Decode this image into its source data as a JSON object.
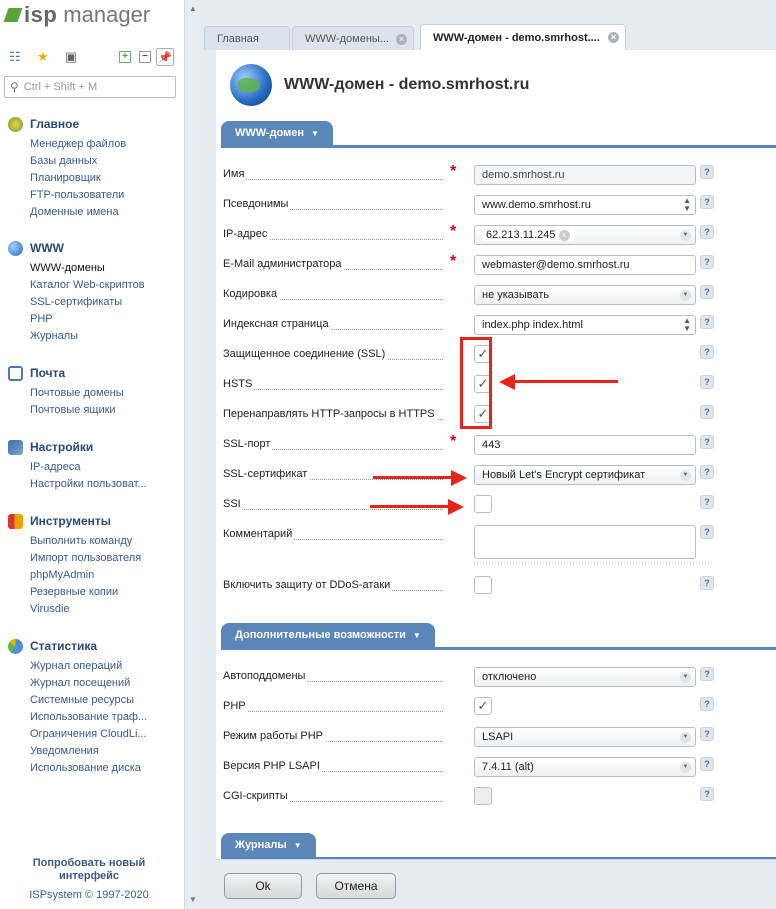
{
  "app": {
    "logo_isp": "isp",
    "logo_manager": "manager"
  },
  "search": {
    "placeholder": "Ctrl + Shift + M"
  },
  "sidebar": {
    "sections": [
      {
        "title": "Главное",
        "items": [
          "Менеджер файлов",
          "Базы данных",
          "Планировщик",
          "FTP-пользователи",
          "Доменные имена"
        ]
      },
      {
        "title": "WWW",
        "items": [
          "WWW-домены",
          "Каталог Web-скриптов",
          "SSL-сертификаты",
          "PHP",
          "Журналы"
        ]
      },
      {
        "title": "Почта",
        "items": [
          "Почтовые домены",
          "Почтовые ящики"
        ]
      },
      {
        "title": "Настройки",
        "items": [
          "IP-адреса",
          "Настройки пользоват..."
        ]
      },
      {
        "title": "Инструменты",
        "items": [
          "Выполнить команду",
          "Импорт пользователя",
          "phpMyAdmin",
          "Резервные копии",
          "Virusdie"
        ]
      },
      {
        "title": "Статистика",
        "items": [
          "Журнал операций",
          "Журнал посещений",
          "Системные ресурсы",
          "Использование траф...",
          "Ограничения CloudLi...",
          "Уведомления",
          "Использование диска"
        ]
      }
    ],
    "active_item": "WWW-домены",
    "try_new": "Попробовать новый интерфейс",
    "copyright": "ISPsystem © 1997-2020"
  },
  "tabs": [
    {
      "label": "Главная"
    },
    {
      "label": "WWW-домены..."
    },
    {
      "label": "WWW-домен - demo.smrhost...."
    }
  ],
  "page": {
    "title": "WWW-домен - demo.smrhost.ru"
  },
  "groups": {
    "main": "WWW-домен",
    "extra": "Дополнительные возможности",
    "logs": "Журналы"
  },
  "form": {
    "name": {
      "label": "Имя",
      "value": "demo.smrhost.ru"
    },
    "aliases": {
      "label": "Псевдонимы",
      "value": "www.demo.smrhost.ru"
    },
    "ip": {
      "label": "IP-адрес",
      "value": "62.213.11.245"
    },
    "email": {
      "label": "E-Mail администратора",
      "value": "webmaster@demo.smrhost.ru"
    },
    "charset": {
      "label": "Кодировка",
      "value": "не указывать"
    },
    "index": {
      "label": "Индексная страница",
      "value": "index.php index.html"
    },
    "ssl": {
      "label": "Защищенное соединение (SSL)",
      "checked": true
    },
    "hsts": {
      "label": "HSTS",
      "checked": true
    },
    "redirect": {
      "label": "Перенаправлять HTTP-запросы в HTTPS",
      "checked": true
    },
    "ssl_port": {
      "label": "SSL-порт",
      "value": "443"
    },
    "ssl_cert": {
      "label": "SSL-сертификат",
      "value": "Новый Let's Encrypt сертификат"
    },
    "ssi": {
      "label": "SSI",
      "checked": false
    },
    "comment": {
      "label": "Комментарий",
      "value": ""
    },
    "ddos": {
      "label": "Включить защиту от DDoS-атаки",
      "checked": false
    },
    "autosub": {
      "label": "Автоподдомены",
      "value": "отключено"
    },
    "php": {
      "label": "PHP",
      "checked": true
    },
    "php_mode": {
      "label": "Режим работы PHP",
      "value": "LSAPI"
    },
    "php_version": {
      "label": "Версия PHP LSAPI",
      "value": "7.4.11 (alt)"
    },
    "cgi": {
      "label": "CGI-скрипты",
      "checked": false
    }
  },
  "buttons": {
    "ok": "Ok",
    "cancel": "Отмена"
  },
  "colors": {
    "accent": "#5b86b8",
    "annotation": "#e5251a",
    "required": "#d0021b"
  }
}
